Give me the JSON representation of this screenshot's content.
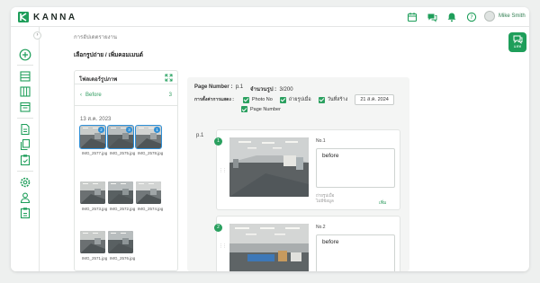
{
  "header": {
    "logo_text": "KANNA",
    "user_name": "Mike Smith",
    "icons": [
      "calendar-icon",
      "chat-icon",
      "bell-icon",
      "help-icon"
    ]
  },
  "colors": {
    "brand": "#1e9e5a",
    "selection": "#2e8fd6"
  },
  "breadcrumb": "การอัปเดตรายงาน",
  "title": "เลือกรูปถ่าย / เพิ่มคอมเมนต์",
  "chat_label": "แชท",
  "folder_panel": {
    "title": "โฟลเดอร์รูปภาพ",
    "folder_name": "Before",
    "folder_count": "3",
    "date": "13 ส.ค. 2023",
    "thumbnails": [
      {
        "label": "IMG_2577.jpg",
        "selected": true,
        "num": "2"
      },
      {
        "label": "IMG_2575.jpg",
        "selected": true,
        "num": "3"
      },
      {
        "label": "IMG_2578.jpg",
        "selected": true,
        "num": "1"
      },
      {
        "label": "IMG_2573.jpg",
        "selected": false,
        "num": ""
      },
      {
        "label": "IMG_2572.jpg",
        "selected": false,
        "num": ""
      },
      {
        "label": "IMG_2574.jpg",
        "selected": false,
        "num": ""
      },
      {
        "label": "IMG_2571.jpg",
        "selected": false,
        "num": ""
      },
      {
        "label": "IMG_2576.jpg",
        "selected": false,
        "num": ""
      }
    ]
  },
  "content": {
    "page_number_label": "Page Number :",
    "page_number_value": "p.1",
    "photo_count_label": "จำนวนรูป :",
    "photo_count_value": "3/200",
    "display_label": "การตั้งค่าการแสดง :",
    "option_photo_no": "Photo No",
    "option_date_taken": "ถ่ายรูปเมื่อ",
    "option_shoot_date": "วันที่สร้าง",
    "date_value": "21 ส.ค. 2024",
    "option_page_number": "Page Number",
    "page_label": "p.1",
    "cards": [
      {
        "badge": "1",
        "no": "No.1",
        "note": "before",
        "meta_line1": "ถ่ายรูปเมื่อ",
        "meta_line2": "ไม่มีข้อมูล",
        "add_label": "เพิ่ม"
      },
      {
        "badge": "2",
        "no": "No.2",
        "note": "before",
        "meta_line1": "",
        "meta_line2": "",
        "add_label": ""
      }
    ]
  }
}
